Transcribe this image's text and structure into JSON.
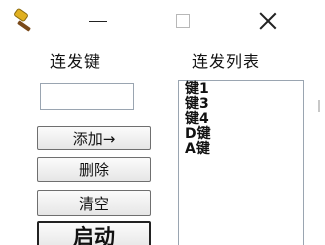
{
  "titlebar": {
    "app_icon": "hammer-icon",
    "minimize_icon": "minimize-icon",
    "maximize_icon": "maximize-icon",
    "close_icon": "close-icon"
  },
  "labels": {
    "key": "连发键",
    "list": "连发列表"
  },
  "key_input": {
    "value": ""
  },
  "buttons": {
    "add": "添加→",
    "delete": "删除",
    "clear": "清空",
    "start": "启动"
  },
  "list": {
    "items": [
      "键1",
      "键3",
      "键4",
      "D键",
      "A键"
    ]
  }
}
